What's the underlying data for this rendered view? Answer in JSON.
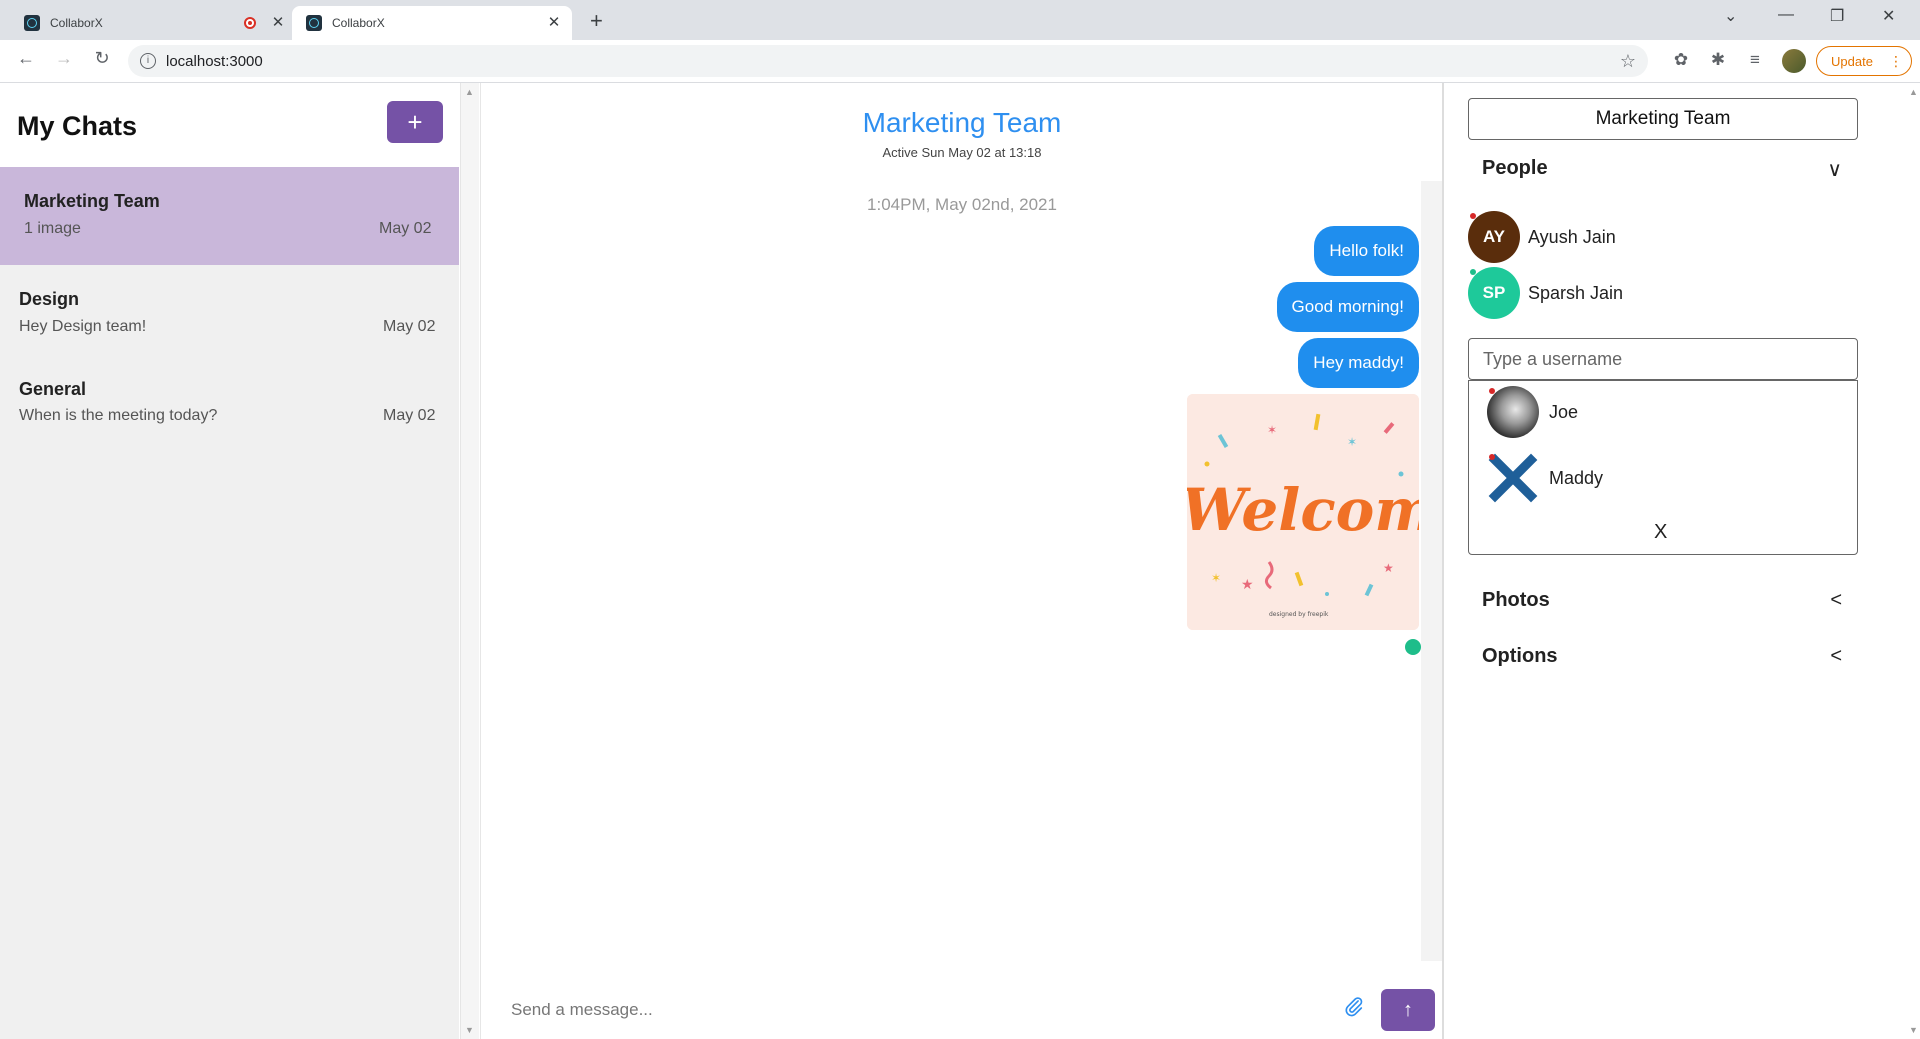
{
  "browser": {
    "tabs": [
      {
        "title": "CollaborX",
        "recording": true
      },
      {
        "title": "CollaborX",
        "active": true
      }
    ],
    "url": "localhost:3000",
    "update_label": "Update"
  },
  "sidebar": {
    "heading": "My Chats",
    "add_label": "+",
    "chats": [
      {
        "name": "Marketing Team",
        "preview": "1 image",
        "date": "May 02",
        "active": true
      },
      {
        "name": "Design",
        "preview": "Hey Design team!",
        "date": "May 02"
      },
      {
        "name": "General",
        "preview": "When is the meeting today?",
        "date": "May 02"
      }
    ]
  },
  "chat": {
    "title": "Marketing Team",
    "subtitle": "Active Sun May 02 at 13:18",
    "timestamp": "1:04PM, May 02nd, 2021",
    "messages": [
      "Hello folk!",
      "Good morning!",
      "Hey maddy!"
    ],
    "image_text": "Welcome",
    "image_caption": "designed by freepik",
    "input_placeholder": "Send a message...",
    "send_label": "↑"
  },
  "details": {
    "title": "Marketing Team",
    "people_heading": "People",
    "people": [
      {
        "initials": "AY",
        "name": "Ayush Jain",
        "color": "#5a2d0c",
        "status": "#d62828"
      },
      {
        "initials": "SP",
        "name": "Sparsh Jain",
        "color": "#1ec99a",
        "status": "#1ebd8a"
      }
    ],
    "username_placeholder": "Type a username",
    "suggestions": [
      {
        "name": "Joe"
      },
      {
        "name": "Maddy"
      }
    ],
    "close_label": "X",
    "photos_heading": "Photos",
    "options_heading": "Options"
  },
  "colors": {
    "accent_purple": "#7552a6",
    "bubble_blue": "#1f8eee",
    "active_chat": "#c9b7da",
    "title_blue": "#2e8ff0"
  }
}
